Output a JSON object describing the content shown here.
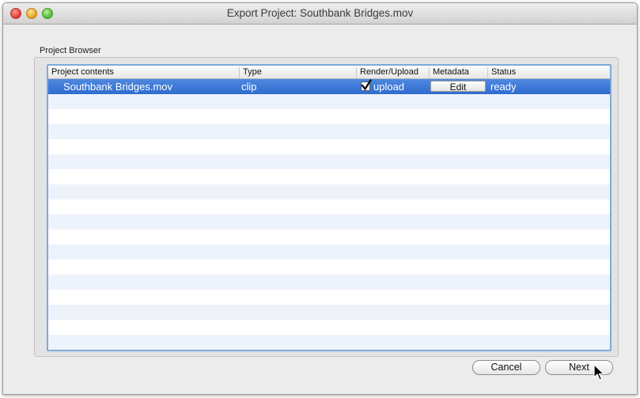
{
  "window": {
    "title": "Export Project: Southbank Bridges.mov"
  },
  "project_browser": {
    "label": "Project Browser",
    "columns": [
      "Project contents",
      "Type",
      "Render/Upload",
      "Metadata",
      "Status"
    ],
    "rows": [
      {
        "name": "Southbank Bridges.mov",
        "type": "clip",
        "render_upload": "upload",
        "render_upload_checked": true,
        "metadata_button": "Edit",
        "status": "ready"
      }
    ]
  },
  "buttons": {
    "cancel": "Cancel",
    "next": "Next"
  },
  "icons": {
    "close": "close-icon",
    "minimize": "minimize-icon",
    "zoom": "zoom-icon",
    "checkbox": "checkmark-icon",
    "pointer": "mouse-pointer-icon"
  },
  "colors": {
    "selection": "#3a78d6",
    "focus_ring": "#7eaad8",
    "alt_row": "#eef3fb"
  }
}
